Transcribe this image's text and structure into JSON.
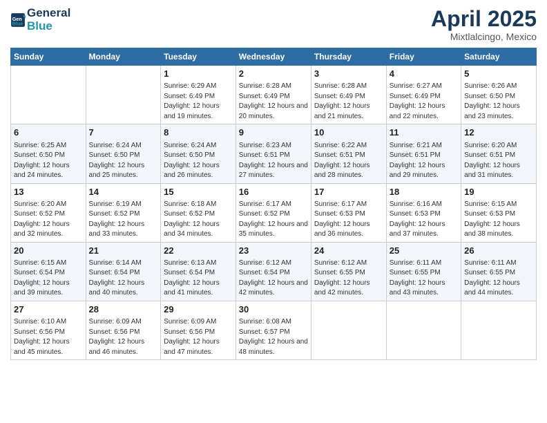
{
  "header": {
    "logo_general": "General",
    "logo_blue": "Blue",
    "month_title": "April 2025",
    "location": "Mixtlalcingo, Mexico"
  },
  "days_of_week": [
    "Sunday",
    "Monday",
    "Tuesday",
    "Wednesday",
    "Thursday",
    "Friday",
    "Saturday"
  ],
  "weeks": [
    [
      {
        "day": "",
        "detail": ""
      },
      {
        "day": "",
        "detail": ""
      },
      {
        "day": "1",
        "detail": "Sunrise: 6:29 AM\nSunset: 6:49 PM\nDaylight: 12 hours and 19 minutes."
      },
      {
        "day": "2",
        "detail": "Sunrise: 6:28 AM\nSunset: 6:49 PM\nDaylight: 12 hours and 20 minutes."
      },
      {
        "day": "3",
        "detail": "Sunrise: 6:28 AM\nSunset: 6:49 PM\nDaylight: 12 hours and 21 minutes."
      },
      {
        "day": "4",
        "detail": "Sunrise: 6:27 AM\nSunset: 6:49 PM\nDaylight: 12 hours and 22 minutes."
      },
      {
        "day": "5",
        "detail": "Sunrise: 6:26 AM\nSunset: 6:50 PM\nDaylight: 12 hours and 23 minutes."
      }
    ],
    [
      {
        "day": "6",
        "detail": "Sunrise: 6:25 AM\nSunset: 6:50 PM\nDaylight: 12 hours and 24 minutes."
      },
      {
        "day": "7",
        "detail": "Sunrise: 6:24 AM\nSunset: 6:50 PM\nDaylight: 12 hours and 25 minutes."
      },
      {
        "day": "8",
        "detail": "Sunrise: 6:24 AM\nSunset: 6:50 PM\nDaylight: 12 hours and 26 minutes."
      },
      {
        "day": "9",
        "detail": "Sunrise: 6:23 AM\nSunset: 6:51 PM\nDaylight: 12 hours and 27 minutes."
      },
      {
        "day": "10",
        "detail": "Sunrise: 6:22 AM\nSunset: 6:51 PM\nDaylight: 12 hours and 28 minutes."
      },
      {
        "day": "11",
        "detail": "Sunrise: 6:21 AM\nSunset: 6:51 PM\nDaylight: 12 hours and 29 minutes."
      },
      {
        "day": "12",
        "detail": "Sunrise: 6:20 AM\nSunset: 6:51 PM\nDaylight: 12 hours and 31 minutes."
      }
    ],
    [
      {
        "day": "13",
        "detail": "Sunrise: 6:20 AM\nSunset: 6:52 PM\nDaylight: 12 hours and 32 minutes."
      },
      {
        "day": "14",
        "detail": "Sunrise: 6:19 AM\nSunset: 6:52 PM\nDaylight: 12 hours and 33 minutes."
      },
      {
        "day": "15",
        "detail": "Sunrise: 6:18 AM\nSunset: 6:52 PM\nDaylight: 12 hours and 34 minutes."
      },
      {
        "day": "16",
        "detail": "Sunrise: 6:17 AM\nSunset: 6:52 PM\nDaylight: 12 hours and 35 minutes."
      },
      {
        "day": "17",
        "detail": "Sunrise: 6:17 AM\nSunset: 6:53 PM\nDaylight: 12 hours and 36 minutes."
      },
      {
        "day": "18",
        "detail": "Sunrise: 6:16 AM\nSunset: 6:53 PM\nDaylight: 12 hours and 37 minutes."
      },
      {
        "day": "19",
        "detail": "Sunrise: 6:15 AM\nSunset: 6:53 PM\nDaylight: 12 hours and 38 minutes."
      }
    ],
    [
      {
        "day": "20",
        "detail": "Sunrise: 6:15 AM\nSunset: 6:54 PM\nDaylight: 12 hours and 39 minutes."
      },
      {
        "day": "21",
        "detail": "Sunrise: 6:14 AM\nSunset: 6:54 PM\nDaylight: 12 hours and 40 minutes."
      },
      {
        "day": "22",
        "detail": "Sunrise: 6:13 AM\nSunset: 6:54 PM\nDaylight: 12 hours and 41 minutes."
      },
      {
        "day": "23",
        "detail": "Sunrise: 6:12 AM\nSunset: 6:54 PM\nDaylight: 12 hours and 42 minutes."
      },
      {
        "day": "24",
        "detail": "Sunrise: 6:12 AM\nSunset: 6:55 PM\nDaylight: 12 hours and 42 minutes."
      },
      {
        "day": "25",
        "detail": "Sunrise: 6:11 AM\nSunset: 6:55 PM\nDaylight: 12 hours and 43 minutes."
      },
      {
        "day": "26",
        "detail": "Sunrise: 6:11 AM\nSunset: 6:55 PM\nDaylight: 12 hours and 44 minutes."
      }
    ],
    [
      {
        "day": "27",
        "detail": "Sunrise: 6:10 AM\nSunset: 6:56 PM\nDaylight: 12 hours and 45 minutes."
      },
      {
        "day": "28",
        "detail": "Sunrise: 6:09 AM\nSunset: 6:56 PM\nDaylight: 12 hours and 46 minutes."
      },
      {
        "day": "29",
        "detail": "Sunrise: 6:09 AM\nSunset: 6:56 PM\nDaylight: 12 hours and 47 minutes."
      },
      {
        "day": "30",
        "detail": "Sunrise: 6:08 AM\nSunset: 6:57 PM\nDaylight: 12 hours and 48 minutes."
      },
      {
        "day": "",
        "detail": ""
      },
      {
        "day": "",
        "detail": ""
      },
      {
        "day": "",
        "detail": ""
      }
    ]
  ]
}
